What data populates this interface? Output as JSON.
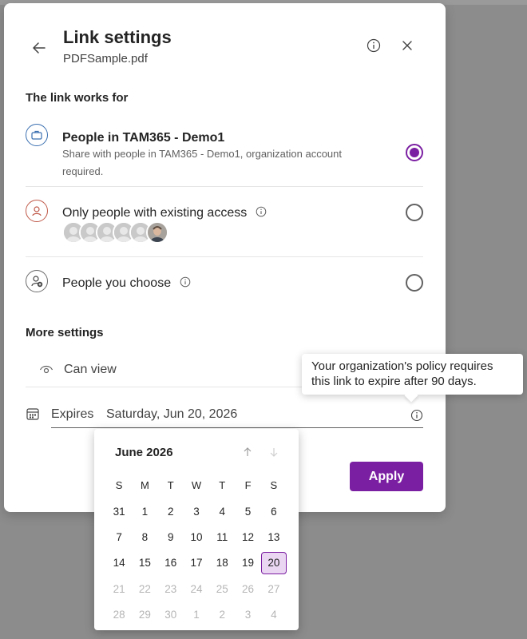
{
  "header": {
    "title": "Link settings",
    "subtitle": "PDFSample.pdf"
  },
  "link_works_for": {
    "label": "The link works for",
    "options": [
      {
        "title": "People in TAM365 - Demo1",
        "description": "Share with people in TAM365 - Demo1, organization account required.",
        "selected": true,
        "icon": "briefcase-icon"
      },
      {
        "title": "Only people with existing access",
        "selected": false,
        "icon": "person-icon",
        "avatar_count": 6
      },
      {
        "title": "People you choose",
        "selected": false,
        "icon": "add-person-icon"
      }
    ]
  },
  "more_settings": {
    "label": "More settings",
    "permission": "Can view",
    "expires_label": "Expires",
    "expires_value": "Saturday, Jun 20, 2026"
  },
  "tooltip": {
    "text": "Your organization's policy requires this link to expire after 90 days."
  },
  "apply_label": "Apply",
  "calendar": {
    "month_label": "June 2026",
    "weekdays": [
      "S",
      "M",
      "T",
      "W",
      "T",
      "F",
      "S"
    ],
    "weeks": [
      [
        "31",
        "1",
        "2",
        "3",
        "4",
        "5",
        "6"
      ],
      [
        "7",
        "8",
        "9",
        "10",
        "11",
        "12",
        "13"
      ],
      [
        "14",
        "15",
        "16",
        "17",
        "18",
        "19",
        "20"
      ],
      [
        "21",
        "22",
        "23",
        "24",
        "25",
        "26",
        "27"
      ],
      [
        "28",
        "29",
        "30",
        "1",
        "2",
        "3",
        "4"
      ]
    ],
    "selected": "20",
    "disabled_after": "20"
  },
  "colors": {
    "accent": "#7b1fa2",
    "selected_day_bg": "#ead6f2"
  }
}
